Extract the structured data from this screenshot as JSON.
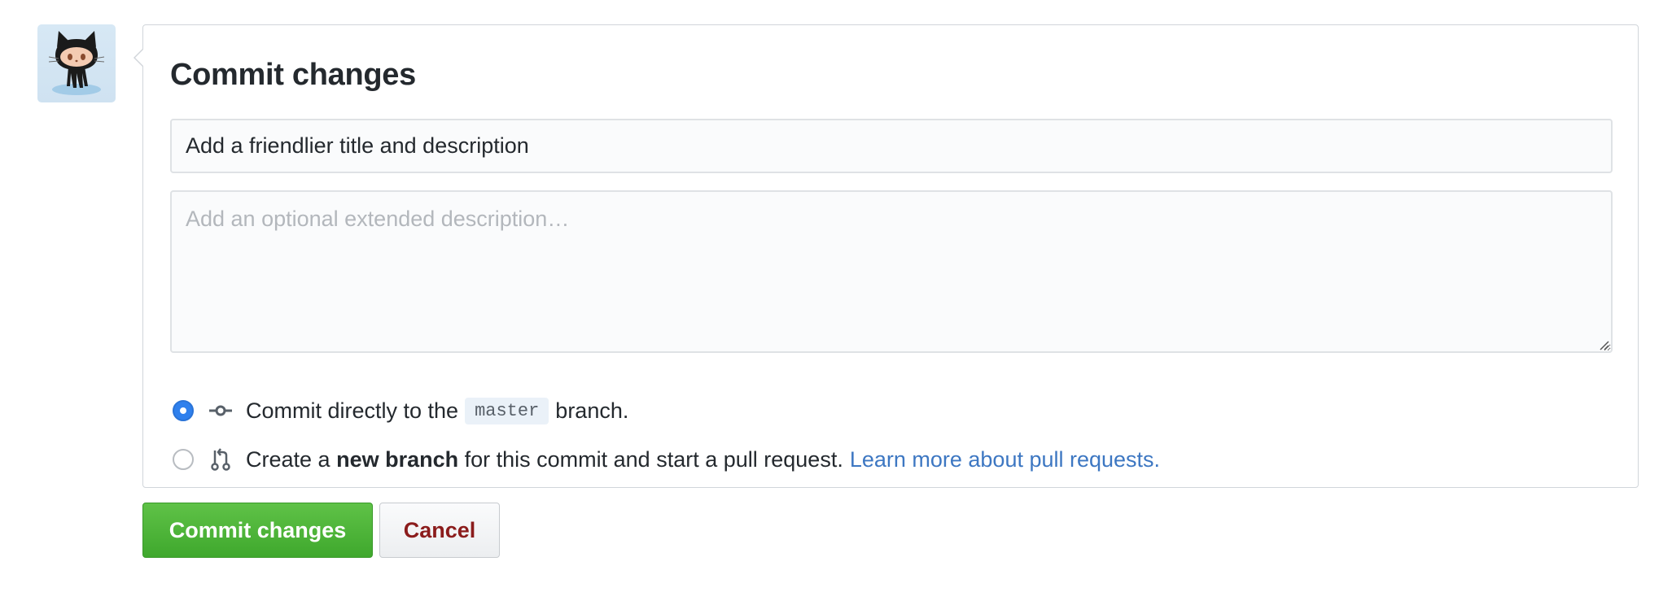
{
  "avatar": {
    "icon": "octocat-icon"
  },
  "form": {
    "title": "Commit changes",
    "summary_value": "Add a friendlier title and description",
    "description_placeholder": "Add an optional extended description…",
    "description_value": ""
  },
  "options": {
    "direct": {
      "selected": true,
      "icon": "git-commit-icon",
      "text_before": "Commit directly to the",
      "branch": "master",
      "text_after": "branch."
    },
    "new_branch": {
      "selected": false,
      "icon": "git-pull-request-icon",
      "text_before": "Create a",
      "bold": "new branch",
      "text_after": "for this commit and start a pull request.",
      "link": "Learn more about pull requests."
    }
  },
  "actions": {
    "commit_label": "Commit changes",
    "cancel_label": "Cancel"
  },
  "colors": {
    "commit_button": "#4cb63a",
    "cancel_text": "#8b1c1c",
    "link": "#3d77c2",
    "radio_selected": "#2f80ed"
  }
}
